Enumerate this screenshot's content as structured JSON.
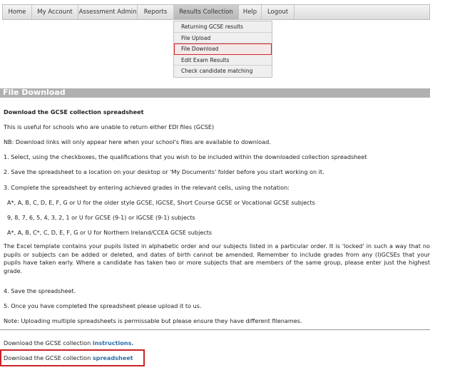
{
  "nav": {
    "items": [
      {
        "label": "Home"
      },
      {
        "label": "My Account"
      },
      {
        "label": "Assessment Admin"
      },
      {
        "label": "Reports"
      },
      {
        "label": "Results Collection"
      },
      {
        "label": "Help"
      },
      {
        "label": "Logout"
      }
    ],
    "active": "Results Collection"
  },
  "dropdown": {
    "items": [
      {
        "label": "Returning GCSE results"
      },
      {
        "label": "File Upload"
      },
      {
        "label": "File Download"
      },
      {
        "label": "Edit Exam Results"
      },
      {
        "label": "Check candidate matching"
      }
    ],
    "highlighted": "File Download"
  },
  "page": {
    "title": "File Download",
    "heading": "Download the GCSE collection spreadsheet",
    "intro": "This is useful for schools who are unable to return either EDI files (GCSE)",
    "nb": "NB: Download links will only appear here when your school's files are available to download.",
    "step1": "1. Select, using the checkboxes, the qualifications that you wish to be included within the downloaded collection spreadsheet",
    "step2": "2. Save the spreadsheet to a location on your desktop or 'My Documents' folder before you start working on it.",
    "step3": "3. Complete the spreadsheet by entering achieved grades in the relevant cells, using the notation:",
    "notation1": "A*, A, B, C, D, E, F, G or U for the older style GCSE, IGCSE, Short Course GCSE or Vocational GCSE subjects",
    "notation2": "9, 8, 7, 6, 5, 4, 3, 2, 1 or U for GCSE (9-1) or IGCSE (9-1) subjects",
    "notation3": "A*, A, B, C*, C, D, E, F, G or U for Northern Ireland/CCEA GCSE subjects",
    "template_note": "The Excel template contains your pupils listed in alphabetic order and our subjects listed in a particular order. It is 'locked' in such a way that no pupils or subjects can be added or deleted, and dates of birth cannot be amended. Remember to include grades from any (I)GCSEs that your pupils have taken early. Where a candidate has taken two or more subjects that are members of the same group, please enter just the highest grade.",
    "step4": "4. Save the spreadsheet.",
    "step5": "5. Once you have completed the spreadsheet please upload it to us.",
    "note": "Note: Uploading multiple spreadsheets is permissable but please ensure they have different filenames.",
    "instructions_prefix": "Download the GCSE collection ",
    "instructions_link": "instructions.",
    "spreadsheet_prefix": "Download the GCSE collection ",
    "spreadsheet_link": "spreadsheet"
  },
  "colors": {
    "highlight_border": "#cc2229",
    "link": "#2c6ea6",
    "title_bar": "#b0b0b0"
  }
}
